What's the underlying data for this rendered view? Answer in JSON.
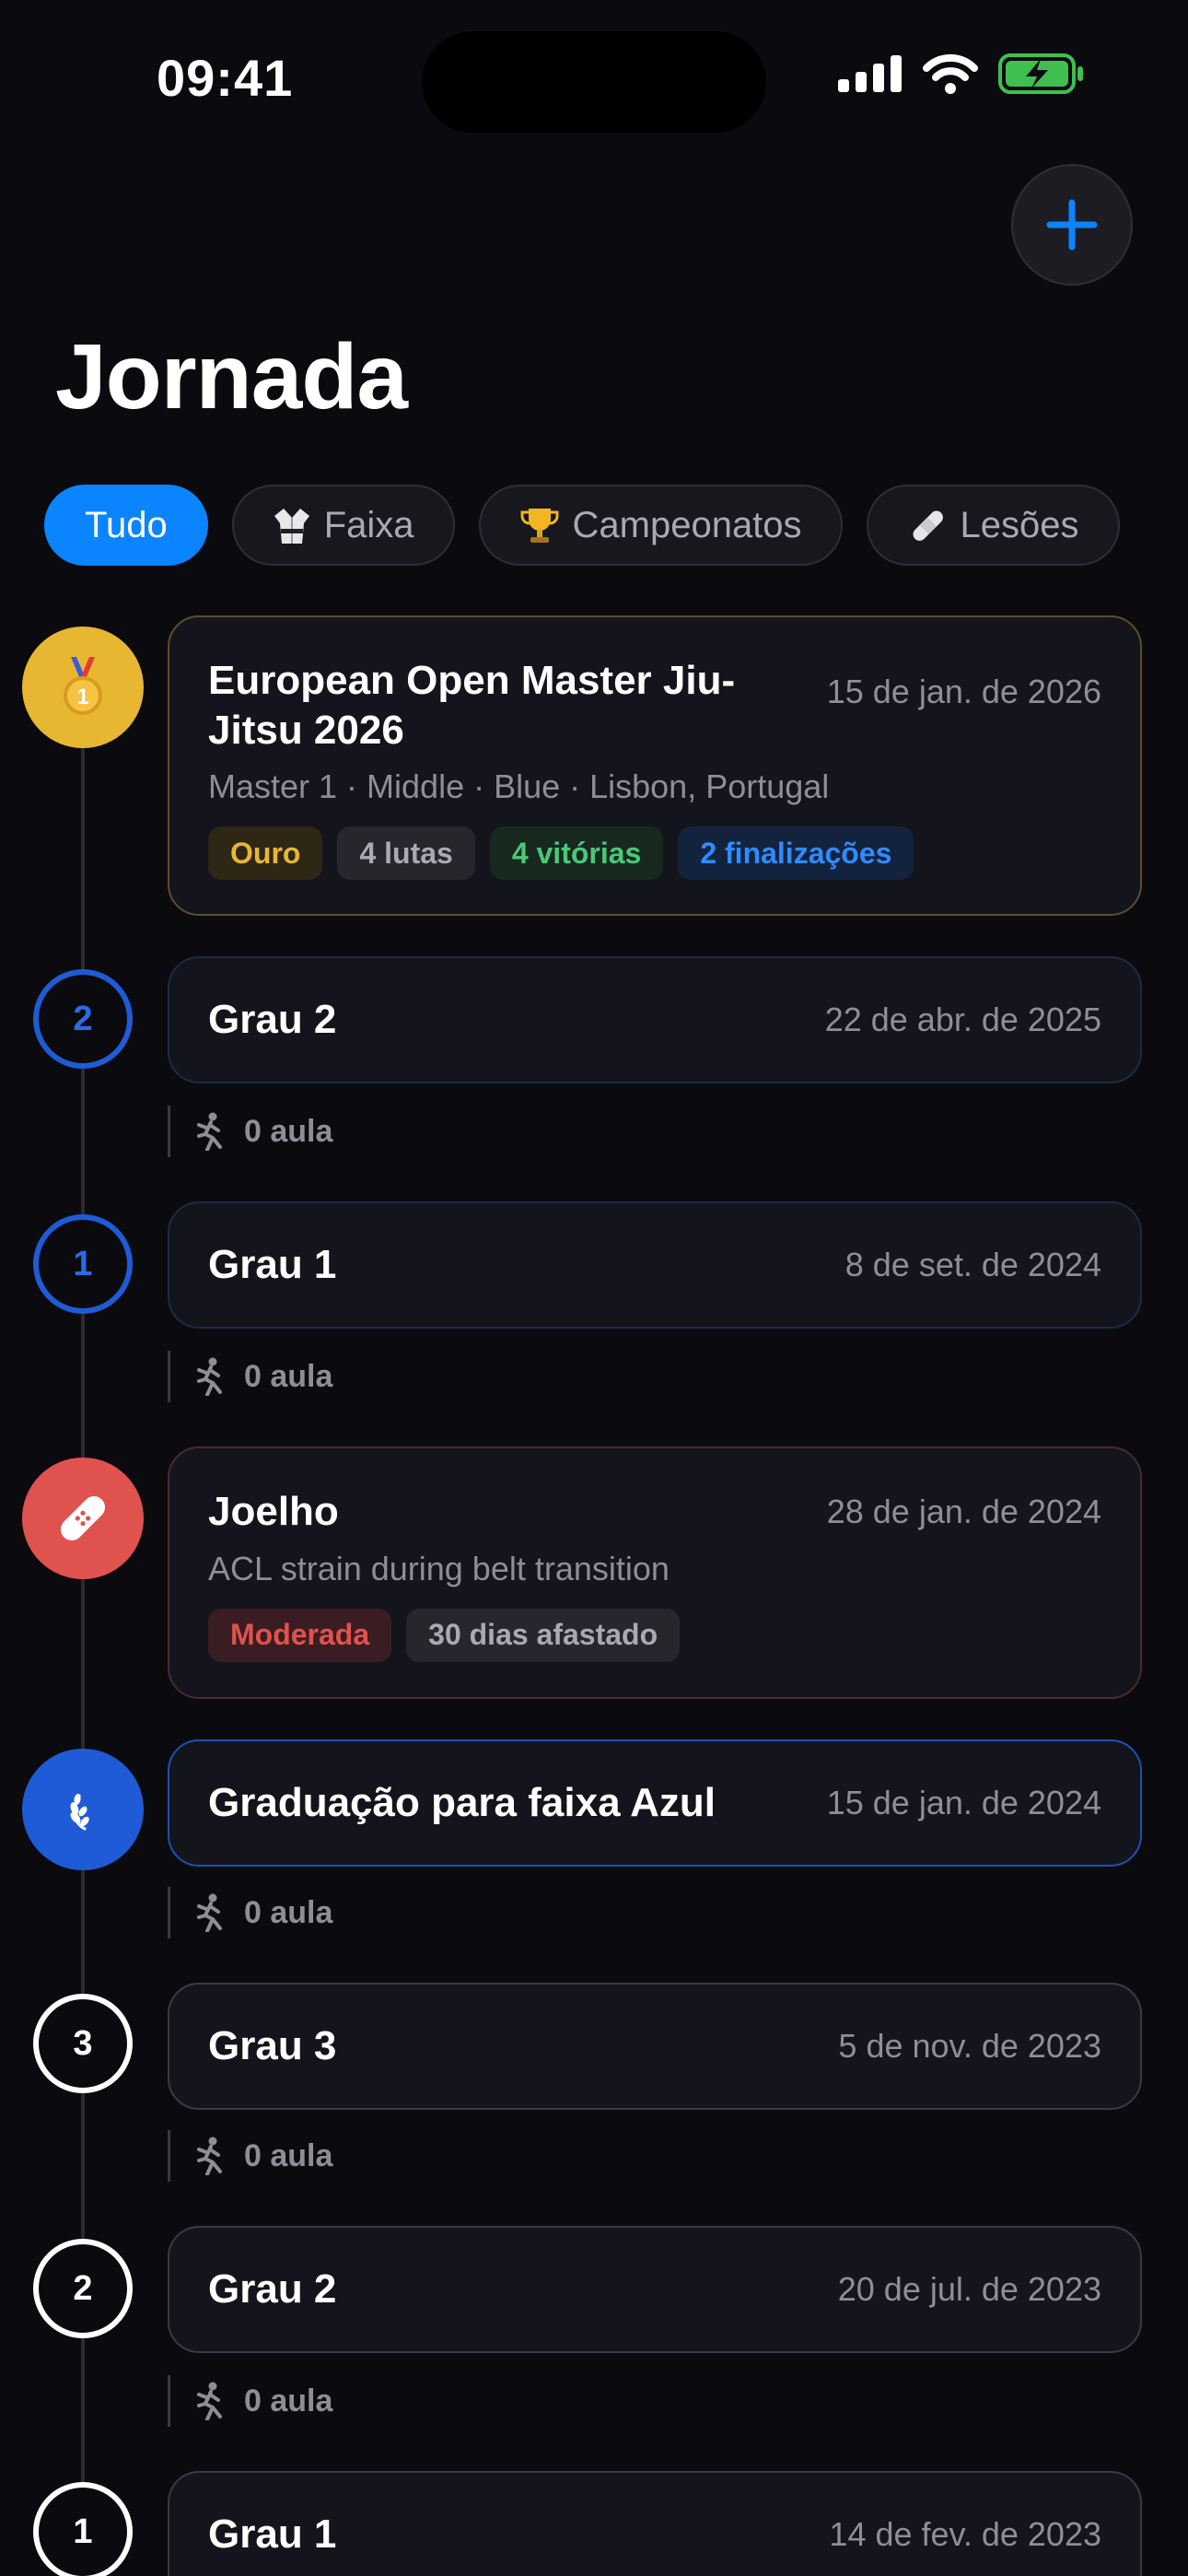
{
  "status_bar": {
    "time": "09:41"
  },
  "header": {
    "title": "Jornada",
    "add_button_icon": "plus-icon"
  },
  "filters": [
    {
      "label": "Tudo",
      "icon": "",
      "active": true
    },
    {
      "label": "Faixa",
      "icon": "gi-icon",
      "active": false
    },
    {
      "label": "Campeonatos",
      "icon": "trophy-icon",
      "active": false
    },
    {
      "label": "Lesões",
      "icon": "bandage-icon",
      "active": false
    }
  ],
  "timeline": {
    "championship": {
      "title": "European Open Master Jiu-Jitsu 2026",
      "date": "15 de jan. de 2026",
      "subtitle": "Master 1 · Middle · Blue · Lisbon, Portugal",
      "tags": [
        "Ouro",
        "4 lutas",
        "4 vitórias",
        "2 finalizações"
      ],
      "icon": "medal-icon"
    },
    "stripe_blue_2": {
      "badge": "2",
      "title": "Grau 2",
      "date": "22 de abr. de 2025",
      "sessions": "0 aula"
    },
    "stripe_blue_1": {
      "badge": "1",
      "title": "Grau 1",
      "date": "8 de set. de 2024",
      "sessions": "0 aula"
    },
    "injury": {
      "title": "Joelho",
      "date": "28 de jan. de 2024",
      "subtitle": "ACL strain during belt transition",
      "tags": [
        "Moderada",
        "30 dias afastado"
      ],
      "icon": "bandage-icon"
    },
    "promotion": {
      "title": "Graduação para faixa Azul",
      "date": "15 de jan. de 2024",
      "sessions": "0 aula",
      "icon": "laurel-icon"
    },
    "stripe_white_3": {
      "badge": "3",
      "title": "Grau 3",
      "date": "5 de nov. de 2023",
      "sessions": "0 aula"
    },
    "stripe_white_2": {
      "badge": "2",
      "title": "Grau 2",
      "date": "20 de jul. de 2023",
      "sessions": "0 aula"
    },
    "stripe_white_1": {
      "badge": "1",
      "title": "Grau 1",
      "date": "14 de fev. de 2023"
    }
  },
  "colors": {
    "accent": "#0a84ff",
    "gold": "#e8b731",
    "blue_belt": "#1f5bd6",
    "injury": "#e0524e",
    "success": "#4cc77a"
  }
}
